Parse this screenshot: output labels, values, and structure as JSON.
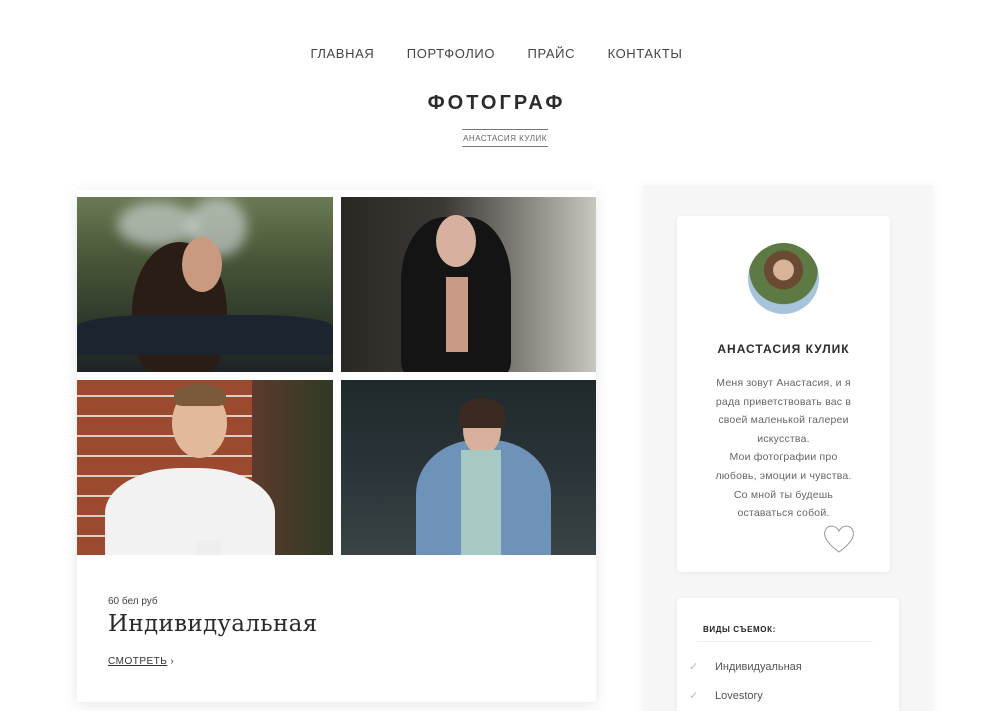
{
  "nav": {
    "items": [
      {
        "label": "ГЛАВНАЯ"
      },
      {
        "label": "ПОРТФОЛИО"
      },
      {
        "label": "ПРАЙС"
      },
      {
        "label": "КОНТАКТЫ"
      }
    ]
  },
  "header": {
    "title": "ФОТОГРАФ",
    "subtitle": "АНАСТАСИЯ КУЛИК"
  },
  "post": {
    "price": "60 бел руб",
    "title": "Индивидуальная",
    "more_label": "СМОТРЕТЬ",
    "more_icon": "chevron-right-icon",
    "photos": [
      "photo-woman-smoke",
      "photo-woman-black-jacket",
      "photo-man-coffee",
      "photo-woman-coat"
    ]
  },
  "sidebar": {
    "about": {
      "name": "АНАСТАСИЯ КУЛИК",
      "text_lines": [
        "Меня зовут Анастасия, и я",
        "рада приветствовать вас в",
        "своей маленькой галереи",
        "искусства.",
        "Мои фотографии про",
        "любовь, эмоции и чувства.",
        "Со мной ты будешь",
        "оставаться собой."
      ],
      "icon": "heart-icon"
    },
    "types": {
      "heading": "ВИДЫ СЪЕМОК:",
      "items": [
        {
          "label": "Индивидуальная",
          "icon": "check-icon"
        },
        {
          "label": "Lovestory",
          "icon": "check-icon"
        }
      ]
    }
  },
  "colors": {
    "text_dark": "#2b2b2b",
    "text_muted": "#666666",
    "sidebar_bg": "#f6f6f6",
    "card_bg": "#ffffff"
  }
}
